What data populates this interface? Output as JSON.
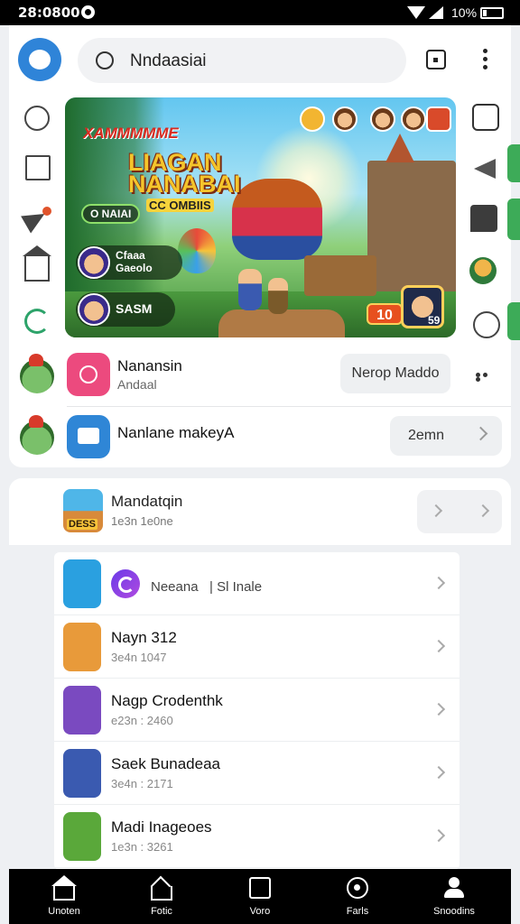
{
  "status": {
    "time": "28:0800",
    "battery": "10%"
  },
  "search": {
    "text": "Nndaasiai"
  },
  "banner": {
    "logo_top": "XAMMMMME",
    "logo_main": "LIAGAN NANABAI",
    "logo_sub": "CC OMBIIS",
    "pill": "O NAIAI",
    "player1": "Cfaaa\nGaeolo",
    "player2": "SASM",
    "score": "10",
    "score_num": "59"
  },
  "feed": [
    {
      "title": "Nanansin",
      "sub": "Andaal",
      "button": "Nerop Maddo",
      "color": "#ec4a7e"
    },
    {
      "title": "Nanlane makeyA",
      "button": "2emn",
      "color": "#2f86d6"
    }
  ],
  "featured": {
    "title": "Mandatqin",
    "sub": "1e3n 1e0ne",
    "tag": "DESS"
  },
  "list": [
    {
      "title": "Neeana",
      "mid": "| Sl Inale",
      "color": "#2aa0e0"
    },
    {
      "title": "Nayn 312",
      "sub": "3e4n 1047",
      "color": "#e89a3a"
    },
    {
      "title": "Nagp Crodenthk",
      "sub": "e23n : 2460",
      "color": "#7a4ac0"
    },
    {
      "title": "Saek Bunadeaa",
      "sub": "3e4n : 2171",
      "color": "#3a5ab0"
    },
    {
      "title": "Madi Inageoes",
      "sub": "1e3n : 3261",
      "color": "#5aa83a"
    }
  ],
  "nav": [
    {
      "label": "Unoten",
      "icon": "home-icon"
    },
    {
      "label": "Fotic",
      "icon": "pentagon-icon"
    },
    {
      "label": "Voro",
      "icon": "inbox-icon"
    },
    {
      "label": "Farls",
      "icon": "badge-icon"
    },
    {
      "label": "Snoodins",
      "icon": "user-icon"
    }
  ]
}
